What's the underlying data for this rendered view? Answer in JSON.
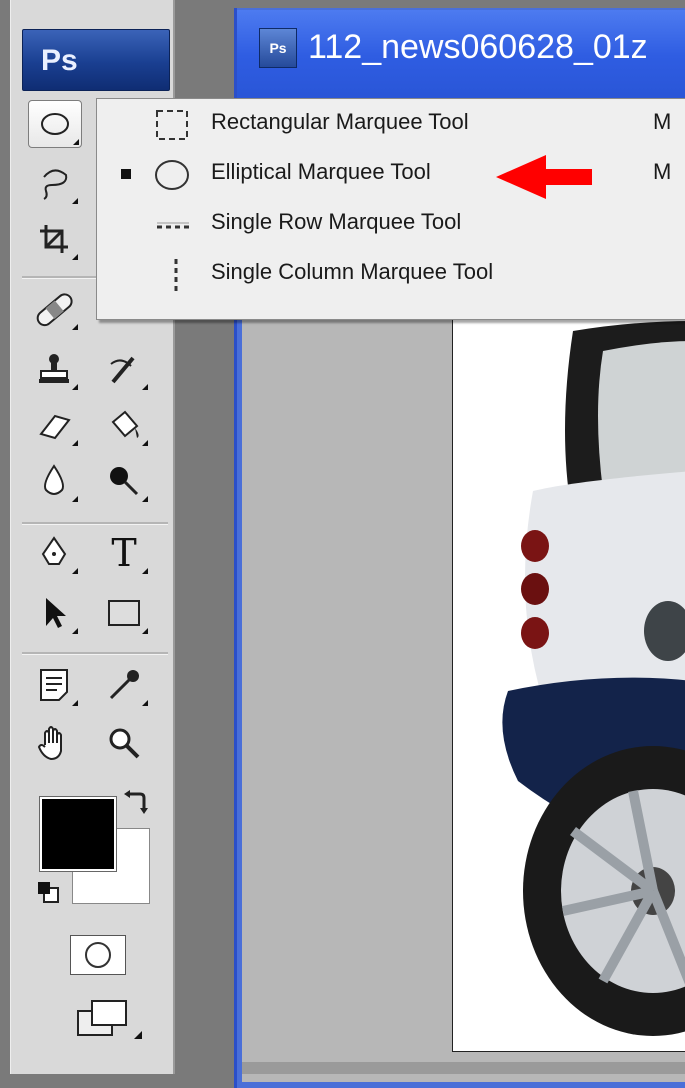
{
  "app": {
    "logo": "Ps"
  },
  "document": {
    "title": "112_news060628_01z",
    "icon_text": "Ps",
    "title_color": "#2f5de2"
  },
  "toolbox": {
    "tools": [
      {
        "name": "elliptical-marquee-tool",
        "icon": "ellipse-marquee-icon",
        "active": true
      },
      {
        "name": "lasso-tool",
        "icon": "lasso-icon"
      },
      {
        "name": "crop-tool",
        "icon": "crop-icon"
      },
      {
        "name": "healing-brush-tool",
        "icon": "bandage-icon"
      },
      {
        "name": "clone-stamp-tool",
        "icon": "stamp-icon"
      },
      {
        "name": "history-brush-tool",
        "icon": "history-brush-icon"
      },
      {
        "name": "eraser-tool",
        "icon": "eraser-icon"
      },
      {
        "name": "paint-bucket-tool",
        "icon": "paint-bucket-icon"
      },
      {
        "name": "blur-tool",
        "icon": "drop-icon"
      },
      {
        "name": "burn-tool",
        "icon": "burn-icon"
      },
      {
        "name": "pen-tool",
        "icon": "pen-icon"
      },
      {
        "name": "type-tool",
        "icon": "type-icon",
        "glyph": "T"
      },
      {
        "name": "path-selection-tool",
        "icon": "arrow-icon"
      },
      {
        "name": "rectangle-tool",
        "icon": "rectangle-icon"
      },
      {
        "name": "notes-tool",
        "icon": "notes-icon"
      },
      {
        "name": "eyedropper-tool",
        "icon": "eyedropper-icon"
      },
      {
        "name": "hand-tool",
        "icon": "hand-icon"
      },
      {
        "name": "zoom-tool",
        "icon": "magnifier-icon"
      }
    ],
    "foreground_color": "#000000",
    "background_color": "#ffffff"
  },
  "flyout": {
    "items": [
      {
        "label": "Rectangular Marquee Tool",
        "shortcut": "M",
        "icon": "rect-marquee-icon",
        "selected": false
      },
      {
        "label": "Elliptical Marquee Tool",
        "shortcut": "M",
        "icon": "ellipse-marquee-icon",
        "selected": true
      },
      {
        "label": "Single Row Marquee Tool",
        "shortcut": "",
        "icon": "single-row-icon",
        "selected": false
      },
      {
        "label": "Single Column Marquee Tool",
        "shortcut": "",
        "icon": "single-column-icon",
        "selected": false
      }
    ],
    "pointer_color": "#ff0000"
  }
}
